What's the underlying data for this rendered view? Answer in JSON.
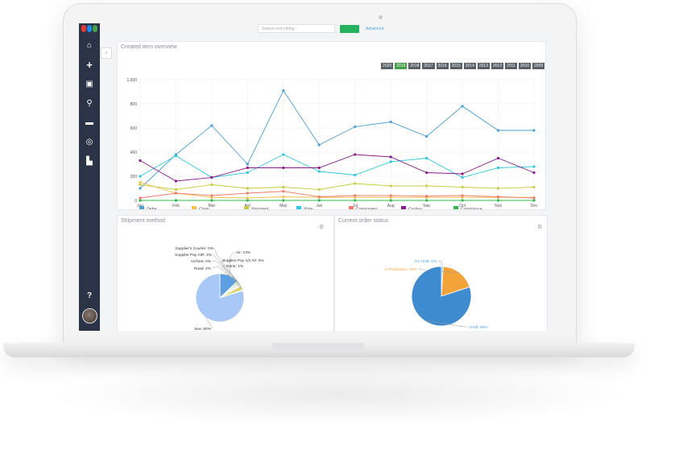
{
  "topbar": {
    "search_placeholder": "Search everything...",
    "advanced_link": "Advanced"
  },
  "sidebar": {
    "items": [
      {
        "icon": "home-icon",
        "glyph": "⌂"
      },
      {
        "icon": "plus-icon",
        "glyph": "+"
      },
      {
        "icon": "report-icon",
        "glyph": "▣"
      },
      {
        "icon": "search-icon",
        "glyph": "⚲"
      },
      {
        "icon": "folder-icon",
        "glyph": "▬"
      },
      {
        "icon": "target-icon",
        "glyph": "◎"
      },
      {
        "icon": "factory-icon",
        "glyph": "▙"
      }
    ],
    "help_glyph": "?"
  },
  "overview": {
    "title": "Created item overview",
    "years": [
      "2020",
      "2019",
      "2018",
      "2017",
      "2016",
      "2015",
      "2014",
      "2013",
      "2012",
      "2011",
      "2010",
      "2009"
    ],
    "active_year": "2019"
  },
  "shipment": {
    "title": "Shipment method"
  },
  "order_status": {
    "title": "Current order status"
  },
  "colors": {
    "sidebar": "#2b3346",
    "accent_green": "#25b15d",
    "order": "#4a9fd8",
    "claim": "#f6c04f",
    "shipment": "#c9cc3f",
    "style": "#2cc7e0",
    "component": "#f07b6e",
    "costing": "#8a1a8a",
    "compliance": "#2db84b"
  },
  "chart_data": [
    {
      "type": "line",
      "x": [
        "Jan",
        "Feb",
        "Mar",
        "Apr",
        "May",
        "Jun",
        "Jul",
        "Aug",
        "Sep",
        "Oct",
        "Nov",
        "Dec"
      ],
      "ylim": [
        0,
        1000
      ],
      "yticks": [
        "0",
        "200",
        "400",
        "600",
        "800",
        "1,000"
      ],
      "grid": true,
      "legend_position": "bottom",
      "series": [
        {
          "name": "Order",
          "color": "#4a9fd8",
          "values": [
            100,
            380,
            620,
            300,
            910,
            460,
            610,
            650,
            530,
            780,
            580,
            580
          ]
        },
        {
          "name": "Claim",
          "color": "#f6c04f",
          "values": [
            150,
            60,
            25,
            20,
            30,
            25,
            25,
            25,
            25,
            25,
            25,
            25
          ]
        },
        {
          "name": "Shipment",
          "color": "#c9cc3f",
          "values": [
            130,
            90,
            130,
            100,
            110,
            90,
            140,
            120,
            120,
            110,
            100,
            110
          ]
        },
        {
          "name": "Style",
          "color": "#2cc7e0",
          "values": [
            200,
            370,
            190,
            230,
            380,
            240,
            210,
            320,
            350,
            190,
            270,
            280
          ]
        },
        {
          "name": "Component",
          "color": "#f07b6e",
          "values": [
            20,
            60,
            40,
            60,
            75,
            30,
            40,
            40,
            35,
            40,
            30,
            20
          ]
        },
        {
          "name": "Costing",
          "color": "#8a1a8a",
          "values": [
            330,
            160,
            190,
            270,
            270,
            270,
            380,
            360,
            230,
            220,
            350,
            230
          ]
        },
        {
          "name": "Compliance",
          "color": "#2db84b",
          "values": [
            0,
            0,
            0,
            0,
            0,
            0,
            0,
            0,
            0,
            0,
            0,
            0
          ]
        }
      ]
    },
    {
      "type": "pie",
      "slices": [
        {
          "label": "Air: 13%",
          "value": 13,
          "color": "#5d9fe0"
        },
        {
          "label": "Supplier Pay 1/2 Air: 0%",
          "value": 0.4,
          "color": "#c9d94a"
        },
        {
          "label": "None: 1%",
          "value": 1,
          "color": "#9bd96b"
        },
        {
          "label": "Road: 2%",
          "value": 2,
          "color": "#e9e9e9"
        },
        {
          "label": "Supplier's Courier: 0%",
          "value": 0.4,
          "color": "#f0c060"
        },
        {
          "label": "Supplier Pay AIR: 3%",
          "value": 3,
          "color": "#d9d36a"
        },
        {
          "label": "Air/Sea: 0%",
          "value": 0.4,
          "color": "#6fcf97"
        },
        {
          "label": "Sea: 80%",
          "value": 80,
          "color": "#a9c8f7"
        }
      ]
    },
    {
      "type": "pie",
      "slices": [
        {
          "label": "On Hold: 1%",
          "value": 1,
          "color": "#7cc7e8"
        },
        {
          "label": "In Production: 19%",
          "value": 19,
          "color": "#f2a33a"
        },
        {
          "label": "Draft: 80%",
          "value": 80,
          "color": "#3f8bd0"
        }
      ]
    }
  ]
}
